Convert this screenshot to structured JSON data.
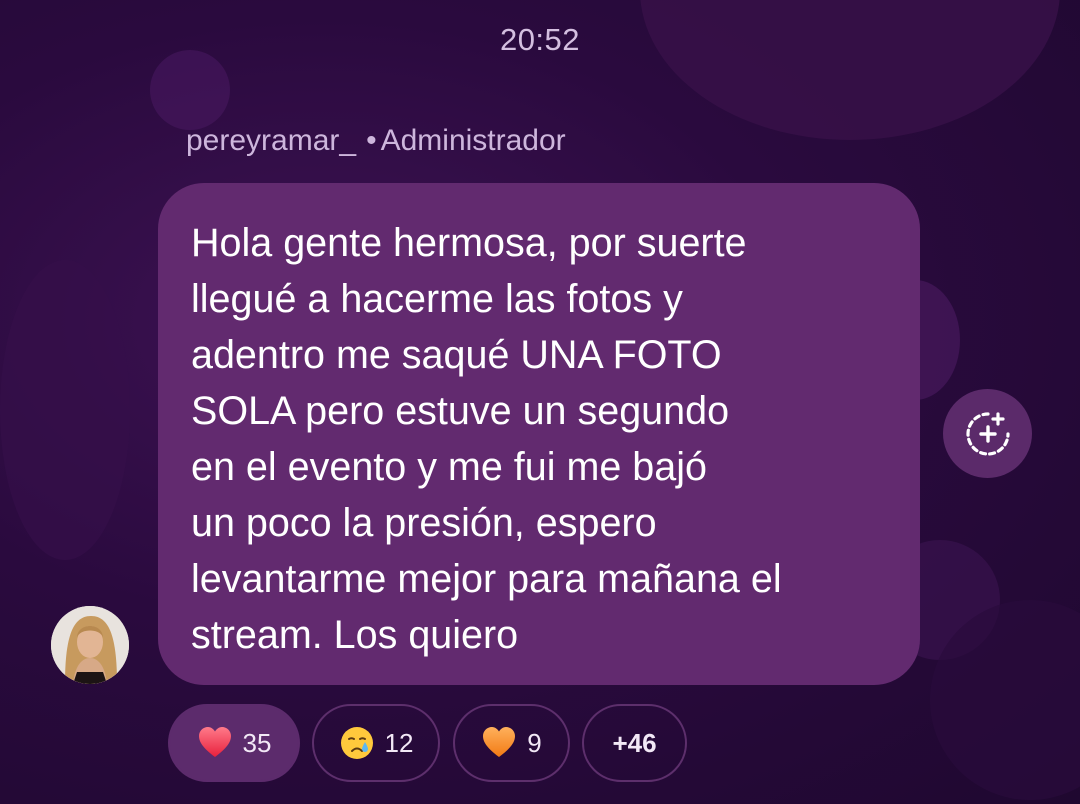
{
  "header": {
    "time": "20:52"
  },
  "message": {
    "sender_name": "pereyramar_",
    "separator": "•",
    "sender_role": "Administrador",
    "lines": [
      "Hola gente hermosa, por suerte",
      "llegué a hacerme las fotos y",
      "adentro me saqué UNA FOTO",
      "SOLA pero estuve un segundo",
      "en el evento y me fui me bajó",
      "un poco la presión, espero",
      "levantarme mejor para mañana el",
      "stream. Los quiero"
    ]
  },
  "reactions": [
    {
      "icon": "red-heart-icon",
      "count": "35",
      "active": true
    },
    {
      "icon": "crying-face-icon",
      "count": "12",
      "active": false
    },
    {
      "icon": "orange-heart-icon",
      "count": "9",
      "active": false
    },
    {
      "icon": "more-reactions",
      "count": "+46",
      "active": false
    }
  ],
  "add_reaction": {
    "icon": "add-reaction-icon"
  },
  "colors": {
    "background": "#2a0a3e",
    "bubble": "#622a6f",
    "pill_active": "#5c2b6c",
    "pill_border": "#5d2f6c",
    "muted_text": "#cdb6dc"
  }
}
